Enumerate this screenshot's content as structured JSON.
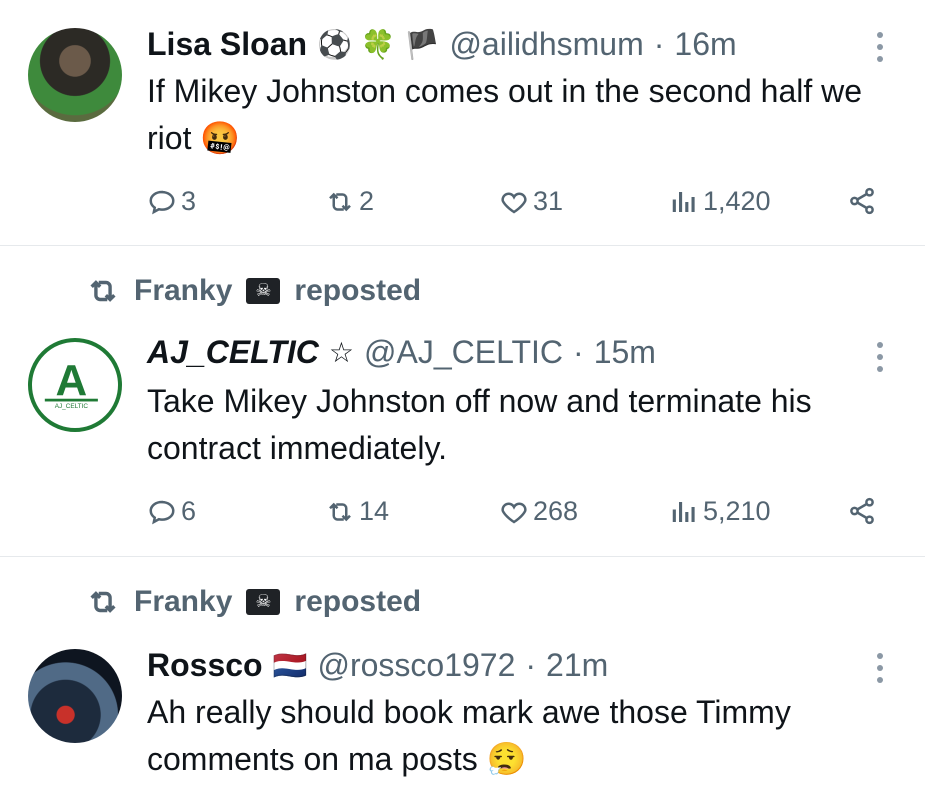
{
  "tweets": [
    {
      "name": "Lisa Sloan",
      "badges": "⚽ 🍀 🏴",
      "handle": "@ailidhsmum",
      "separator": "·",
      "time": "16m",
      "text": "If Mikey Johnston comes out in the second half we riot 🤬",
      "replies": "3",
      "reposts": "2",
      "likes": "31",
      "views": "1,420"
    },
    {
      "reposted_by": "Franky",
      "reposted_label": "reposted",
      "name": "AJ_CELTIC",
      "badges": "☆",
      "handle": "@AJ_CELTIC",
      "separator": "·",
      "time": "15m",
      "text": "Take Mikey Johnston off now and terminate his contract immediately.",
      "replies": "6",
      "reposts": "14",
      "likes": "268",
      "views": "5,210"
    },
    {
      "reposted_by": "Franky",
      "reposted_label": "reposted",
      "name": "Rossco",
      "badges": "🇳🇱",
      "handle": "@rossco1972",
      "separator": "·",
      "time": "21m",
      "text": "Ah really should book mark awe those Timmy comments on ma posts 😮‍💨"
    }
  ],
  "avatars": {
    "aj_logo_letter": "A",
    "aj_logo_caption": "AJ_CELTIC"
  },
  "colors": {
    "secondary_text": "#536471",
    "primary_text": "#0f1419",
    "divider": "#e6e9ec",
    "aj_green": "#1f7a35"
  },
  "icons": [
    "reply-icon",
    "repost-icon",
    "like-icon",
    "views-icon",
    "share-icon",
    "more-icon",
    "pirate-flag-icon"
  ]
}
